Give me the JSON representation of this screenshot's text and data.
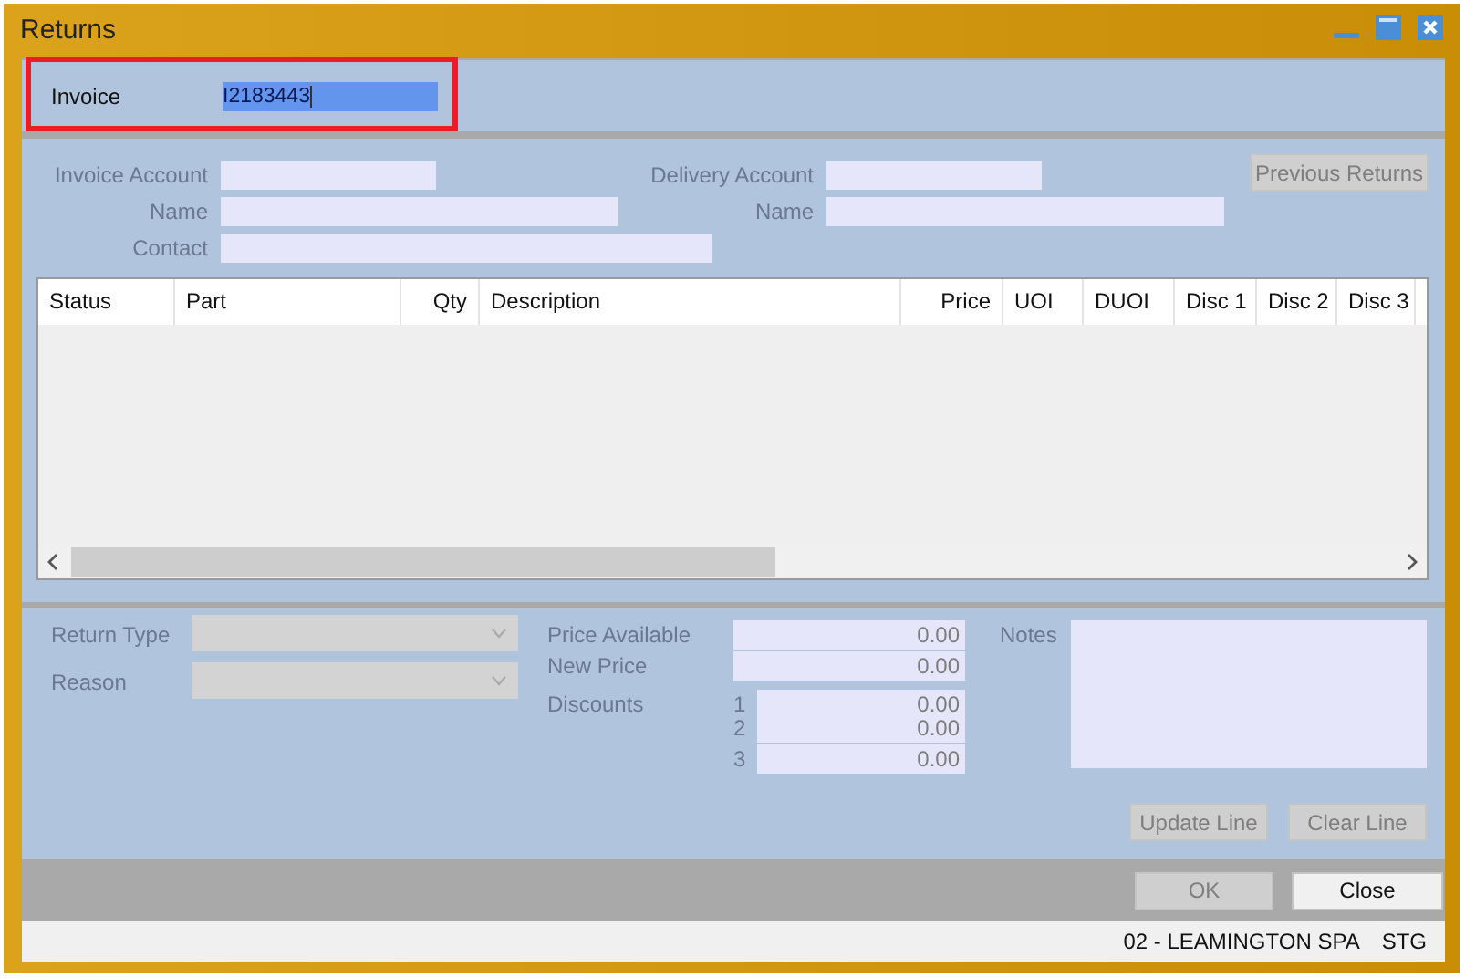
{
  "window": {
    "title": "Returns"
  },
  "invoice": {
    "label": "Invoice",
    "value": "I2183443",
    "selected": true,
    "highlighted": true
  },
  "account_fields": [
    {
      "label": "Invoice Account",
      "disabled": true
    },
    {
      "label": "Delivery Account",
      "disabled": true
    },
    {
      "label": "Name",
      "disabled": true
    },
    {
      "label": "Name",
      "disabled": true
    },
    {
      "label": "Contact",
      "disabled": true
    }
  ],
  "previous_returns_button": {
    "label": "Previous Returns",
    "disabled": true
  },
  "table": {
    "columns": [
      {
        "label": "Status"
      },
      {
        "label": "Part"
      },
      {
        "label": "Qty"
      },
      {
        "label": "Description"
      },
      {
        "label": "Price"
      },
      {
        "label": "UOI"
      },
      {
        "label": "DUOI"
      },
      {
        "label": "Disc 1"
      },
      {
        "label": "Disc 2"
      },
      {
        "label": "Disc 3"
      }
    ]
  },
  "line_editor": {
    "combos": [
      {
        "label": "Return Type",
        "disabled": true
      },
      {
        "label": "Reason",
        "disabled": true
      }
    ],
    "prices": [
      {
        "label": "Price Available",
        "value": "0.00",
        "disabled": true
      },
      {
        "label": "New Price",
        "value": "0.00",
        "disabled": true
      }
    ],
    "discounts": {
      "label": "Discounts",
      "disabled": true,
      "items": [
        {
          "index": "1",
          "value": "0.00"
        },
        {
          "index": "2",
          "value": "0.00"
        },
        {
          "index": "3",
          "value": "0.00"
        }
      ]
    },
    "notes": {
      "label": "Notes",
      "disabled": true
    },
    "buttons": [
      {
        "label": "Update Line",
        "disabled": true
      },
      {
        "label": "Clear Line",
        "disabled": true
      }
    ]
  },
  "dialog_buttons": [
    {
      "label": "OK",
      "disabled": true
    },
    {
      "label": "Close",
      "disabled": false
    }
  ],
  "status_bar": {
    "items": [
      "02 - LEAMINGTON SPA",
      "STG"
    ]
  }
}
